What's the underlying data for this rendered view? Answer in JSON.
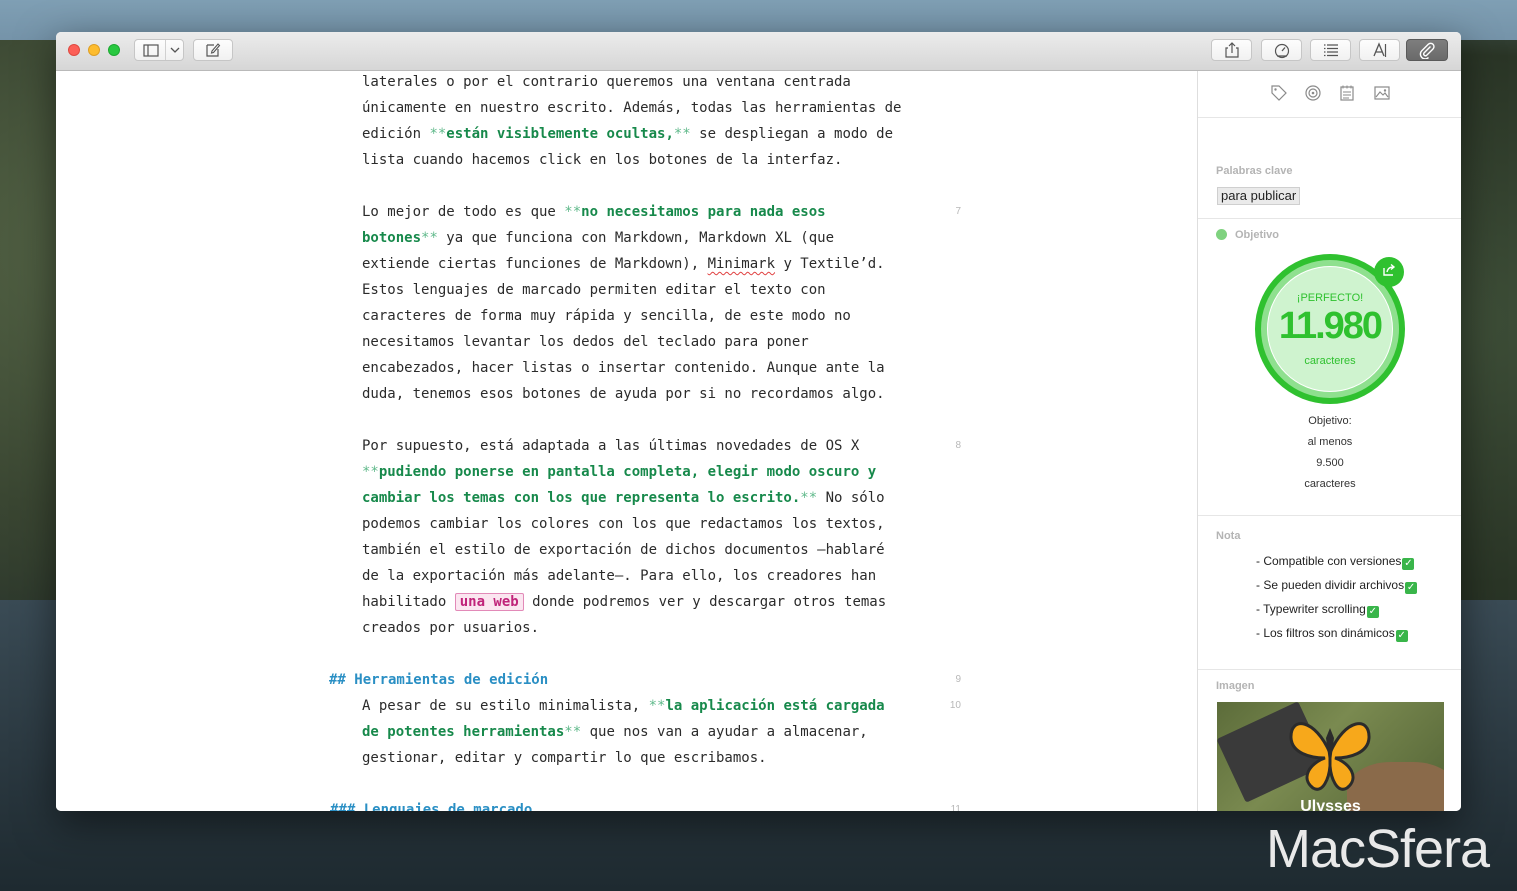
{
  "editor": {
    "lines": [
      [
        "laterales o por el contrario queremos una ventana centrada"
      ],
      [
        "únicamente en nuestro escrito. Además, todas las herramientas de"
      ],
      [
        "edición ",
        {
          "m": "**"
        },
        {
          "b": "están visiblemente ocultas,"
        },
        {
          "m": "**"
        },
        " se despliegan a modo de"
      ],
      [
        "lista cuando hacemos click en los botones de la interfaz."
      ],
      [
        "Lo mejor de todo es que ",
        {
          "m": "**"
        },
        {
          "b": "no necesitamos para nada esos"
        }
      ],
      [
        {
          "b": "botones"
        },
        {
          "m": "**"
        },
        " ya que funciona con Markdown, Markdown XL (que"
      ],
      [
        "extiende ciertas funciones de Markdown), ",
        {
          "s": "Minimark"
        },
        " y Textile’d."
      ],
      [
        "Estos lenguajes de marcado permiten editar el texto con"
      ],
      [
        "caracteres de forma muy rápida y sencilla, de este modo no"
      ],
      [
        "necesitamos levantar los dedos del teclado para poner"
      ],
      [
        "encabezados, hacer listas o insertar contenido. Aunque ante la"
      ],
      [
        "duda, tenemos esos botones de ayuda por si no recordamos algo."
      ],
      [
        "Por supuesto, está adaptada a las últimas novedades de OS X"
      ],
      [
        {
          "m": "**"
        },
        {
          "b": "pudiendo ponerse en pantalla completa, elegir modo oscuro y"
        }
      ],
      [
        {
          "b": "cambiar los temas con los que representa lo escrito."
        },
        {
          "m": "**"
        },
        " No sólo"
      ],
      [
        "podemos cambiar los colores con los que redactamos los textos,"
      ],
      [
        "también el estilo de exportación de dichos documentos —hablaré"
      ],
      [
        "de la exportación más adelante—. Para ello, los creadores han"
      ],
      [
        "habilitado ",
        {
          "l": "una web"
        },
        " donde podremos ver y descargar otros temas"
      ],
      [
        "creados por usuarios."
      ],
      [
        {
          "h": "## Herramientas de edición"
        }
      ],
      [
        "A pesar de su estilo minimalista, ",
        {
          "m": "**"
        },
        {
          "b": "la aplicación está cargada"
        }
      ],
      [
        {
          "b": "de potentes herramientas"
        },
        {
          "m": "**"
        },
        " que nos van a ayudar a almacenar,"
      ],
      [
        "gestionar, editar y compartir lo que escribamos."
      ],
      [
        {
          "h": "### Lenguajes de marcado"
        }
      ]
    ],
    "line_numbers": [
      "7",
      "8",
      "9",
      "10",
      "11"
    ]
  },
  "sidebar": {
    "keywords_label": "Palabras clave",
    "keyword": "para publicar",
    "goal_label": "Objetivo",
    "goal_status": "¡PERFECTO!",
    "goal_count": "11.980",
    "goal_unit": "caracteres",
    "goal_progress": 1.0,
    "goal_desc": [
      "Objetivo:",
      "al menos",
      "9.500",
      "caracteres"
    ],
    "note_label": "Nota",
    "notes": [
      "- Compatible con versiones",
      "- Se pueden dividir archivos",
      "- Typewriter scrolling",
      "- Los filtros son dinámicos"
    ],
    "image_label": "Imagen",
    "image_caption": "Ulysses"
  },
  "watermark": "MacSfera",
  "colors": {
    "bold_green": "#17894b",
    "markup_green": "#5fb98a",
    "heading_blue": "#2a8fc4",
    "link_pink": "#c0247a",
    "goal_green": "#2fc12f",
    "goal_ring_light": "#8fe08f"
  }
}
